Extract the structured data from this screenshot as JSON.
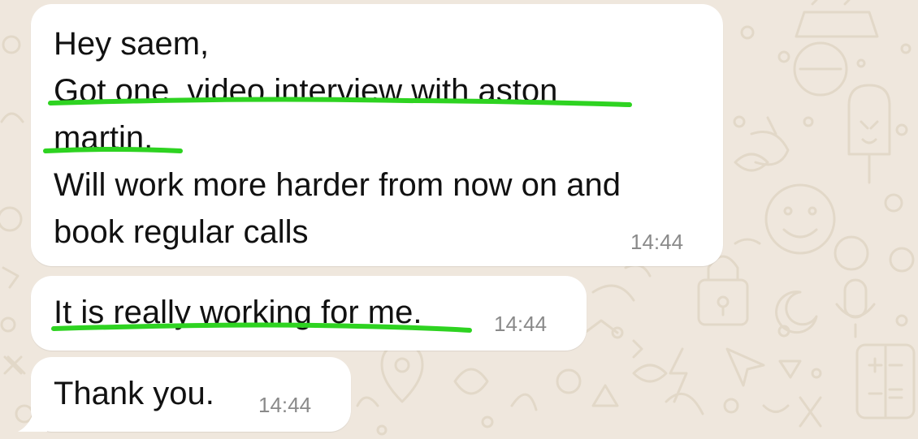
{
  "conversation": {
    "messages": [
      {
        "lines": [
          "Hey saem,",
          "Got one  video interview with aston",
          "martin.",
          "Will work more harder from now on and",
          "book regular calls"
        ],
        "time": "14:44"
      },
      {
        "lines": [
          "It is really working for me."
        ],
        "time": "14:44"
      },
      {
        "lines": [
          "Thank you."
        ],
        "time": "14:44"
      }
    ]
  },
  "colors": {
    "background": "#efe7dd",
    "bubble": "#ffffff",
    "text": "#111111",
    "timestamp": "#8a8a8a",
    "highlight_marker": "#2ed321",
    "doodle_stroke": "#e2d8c8"
  },
  "icons": [
    "doodle-pattern",
    "lock-icon",
    "moon-icon",
    "microphone-icon",
    "calculator-icon",
    "location-pin-icon",
    "popsicle-icon",
    "smiley-icon",
    "cake-icon",
    "chili-icon"
  ]
}
